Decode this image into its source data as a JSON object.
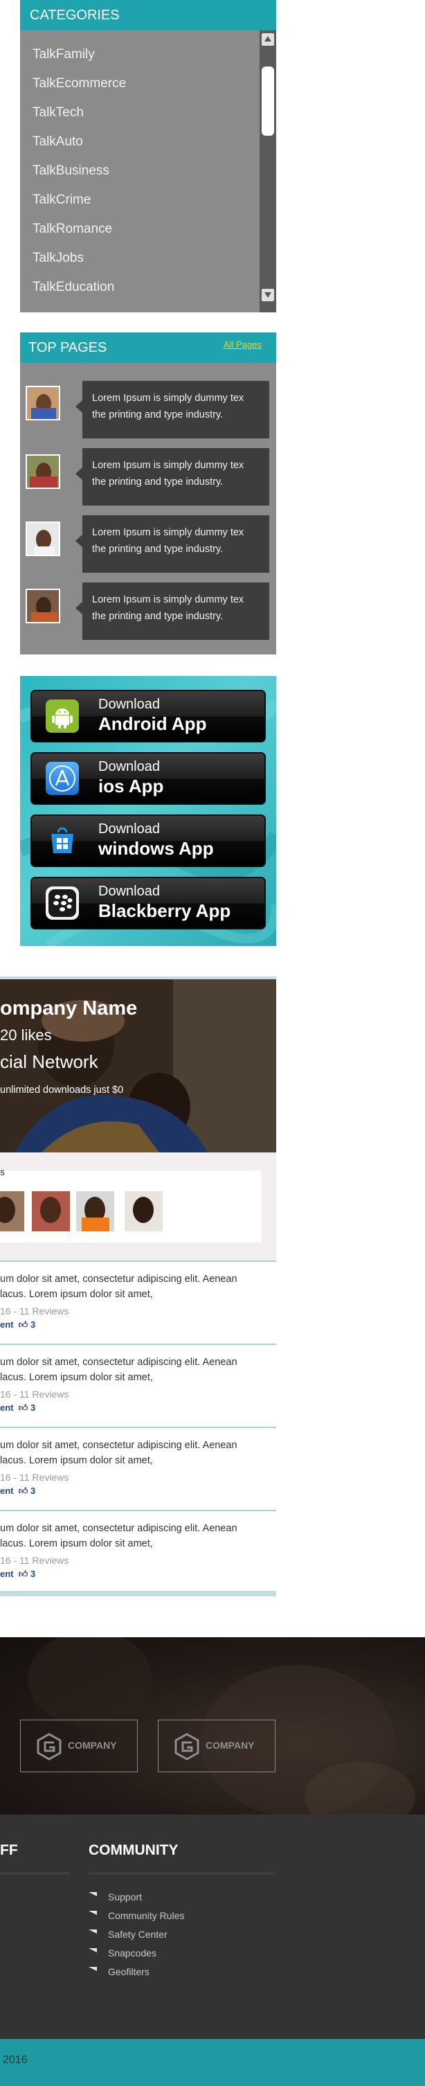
{
  "categories": {
    "title": "CATEGORIES",
    "items": [
      "TalkFamily",
      "TalkEcommerce",
      "TalkTech",
      "TalkAuto",
      "TalkBusiness",
      "TalkCrime",
      "TalkRomance",
      "TalkJobs",
      "TalkEducation"
    ]
  },
  "top_pages": {
    "title": "TOP PAGES",
    "all_link": "All Pages",
    "items": [
      {
        "line1": "Lorem Ipsum is simply dummy tex",
        "line2": "the printing and type industry."
      },
      {
        "line1": "Lorem Ipsum is simply dummy tex",
        "line2": "the printing and type industry."
      },
      {
        "line1": "Lorem Ipsum is simply dummy tex",
        "line2": "the printing and type industry."
      },
      {
        "line1": "Lorem Ipsum is simply dummy tex",
        "line2": "the printing and type industry."
      }
    ]
  },
  "apps": [
    {
      "download": "Download",
      "name": "Android App",
      "icon": "android-icon"
    },
    {
      "download": "Download",
      "name": "ios App",
      "icon": "app-store-icon"
    },
    {
      "download": "Download",
      "name": "windows App",
      "icon": "windows-store-icon"
    },
    {
      "download": "Download",
      "name": "Blackberry App",
      "icon": "blackberry-icon"
    }
  ],
  "company": {
    "name": "ompany Name",
    "likes": "20 likes",
    "network": "cial Network",
    "offer": "unlimited downloads just $0",
    "strip_label": "s"
  },
  "reviews": [
    {
      "line1": "um dolor sit amet, consectetur adipiscing elit. Aenean",
      "line2": "lacus. Lorem ipsum dolor sit amet,",
      "meta": "16 - 11 Reviews",
      "action": "ent",
      "likes": "3"
    },
    {
      "line1": "um dolor sit amet, consectetur adipiscing elit. Aenean",
      "line2": "lacus. Lorem ipsum dolor sit amet,",
      "meta": "16 - 11 Reviews",
      "action": "ent",
      "likes": "3"
    },
    {
      "line1": "um dolor sit amet, consectetur adipiscing elit. Aenean",
      "line2": "lacus. Lorem ipsum dolor sit amet,",
      "meta": "16 - 11 Reviews",
      "action": "ent",
      "likes": "3"
    },
    {
      "line1": "um dolor sit amet, consectetur adipiscing elit. Aenean",
      "line2": "lacus. Lorem ipsum dolor sit amet,",
      "meta": "16 - 11 Reviews",
      "action": "ent",
      "likes": "3"
    }
  ],
  "partners": [
    {
      "label": "COMPANY"
    },
    {
      "label": "COMPANY"
    }
  ],
  "footer": {
    "left_heading": "FF",
    "community_heading": "COMMUNITY",
    "community_links": [
      "Support",
      "Community Rules",
      "Safety Center",
      "Snapcodes",
      "Geofilters"
    ],
    "copyright": "2016"
  },
  "colors": {
    "teal": "#1fa4ad",
    "panel_grey": "#8c8b8c",
    "bubble_dark": "#3d3d3d",
    "link_yellow": "#f3d21a",
    "footer_dark": "#333333"
  }
}
